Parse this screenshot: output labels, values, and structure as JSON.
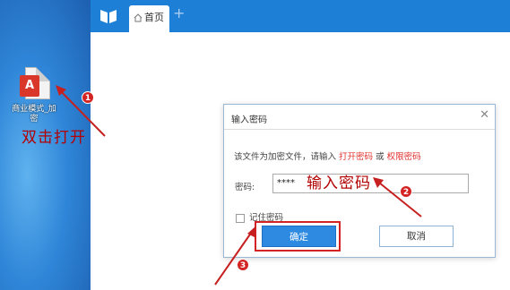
{
  "desktop": {
    "file_icon": "pdf-file-icon",
    "file_label": "商业模式_加密",
    "pdf_glyph": "A",
    "hint_text": "双击打开"
  },
  "app": {
    "tab_label": "首页",
    "new_tab_symbol": "+"
  },
  "dialog": {
    "title": "输入密码",
    "close_symbol": "✕",
    "message_prefix": "该文件为加密文件，请输入",
    "message_open_pw": "打开密码",
    "message_or": "或",
    "message_perm_pw": "权限密码",
    "password_label": "密码:",
    "password_value": "****",
    "remember_label": "记住密码",
    "remember_checked": false,
    "ok_label": "确定",
    "cancel_label": "取消"
  },
  "annotations": {
    "step1": "1",
    "step2": "2",
    "step3": "3",
    "hint_password": "输入密码",
    "color": "#d42323"
  }
}
